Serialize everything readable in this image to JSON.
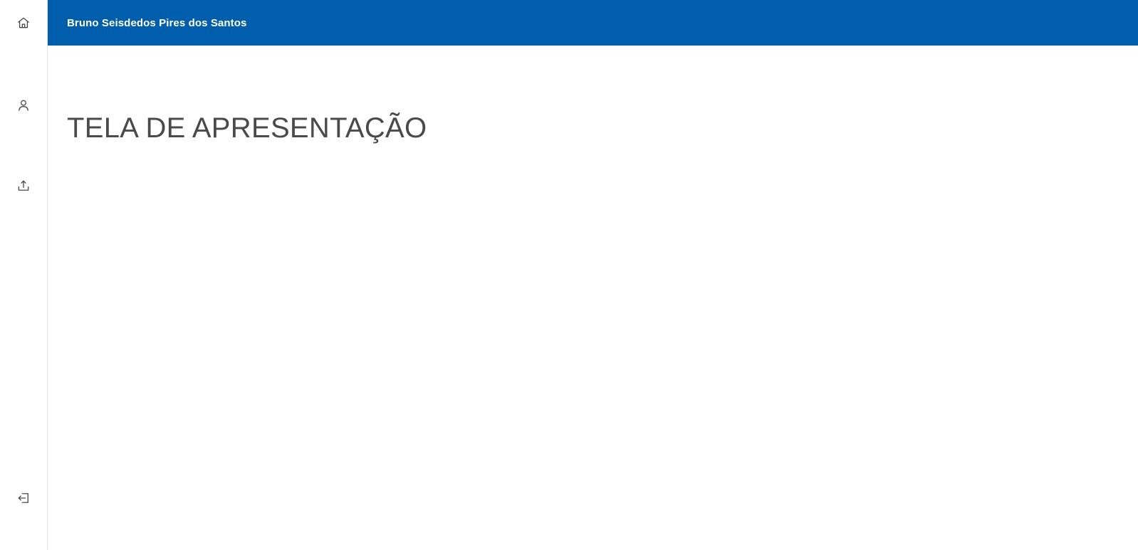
{
  "header": {
    "user_name": "Bruno Seisdedos Pires dos Santos",
    "background_color": "#005eac"
  },
  "sidebar": {
    "items": [
      {
        "id": "home",
        "icon": "home-icon"
      },
      {
        "id": "profile",
        "icon": "user-icon"
      },
      {
        "id": "upload",
        "icon": "upload-icon"
      },
      {
        "id": "logout",
        "icon": "logout-icon"
      }
    ]
  },
  "main": {
    "title": "TELA DE APRESENTAÇÃO",
    "title_color": "#4a4a4a"
  }
}
